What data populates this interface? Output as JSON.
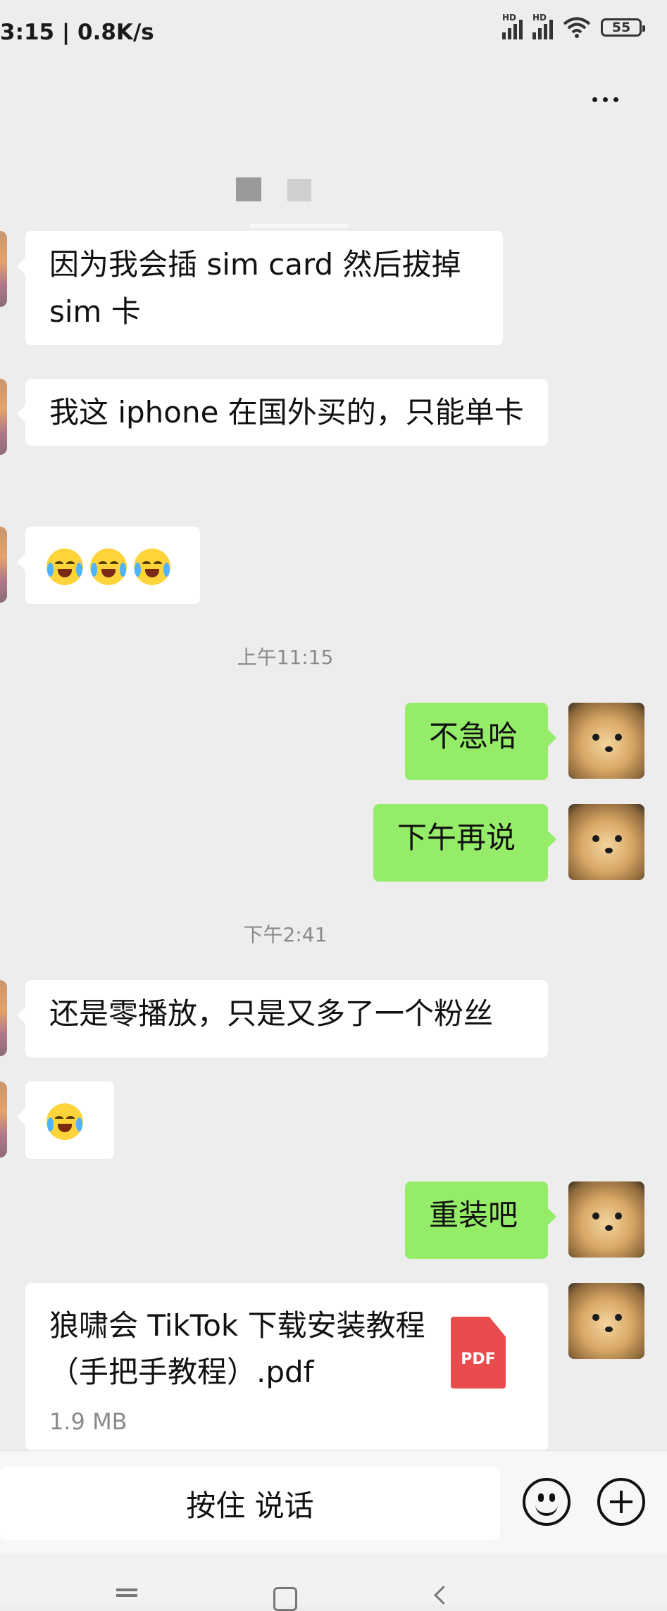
{
  "status_bar": {
    "time_speed": "3:15 | 0.8K/s",
    "sim1_label": "HD",
    "sim2_label": "HD",
    "battery": "55",
    "icons": [
      "signal-icon",
      "signal-icon",
      "wifi-icon",
      "battery-icon"
    ]
  },
  "header": {
    "menu_icon": "more-dots-icon"
  },
  "messages": {
    "m1": "因为我会插 sim card 然后拔掉 sim 卡",
    "m2": "我这 iphone 在国外买的，只能单卡",
    "m6": "还是零播放，只是又多了一个粉丝"
  },
  "timestamps": {
    "t1": "上午11:15",
    "t2": "下午2:41"
  },
  "outgoing": {
    "o1": "不急哈",
    "o2": "下午再说",
    "o3": "重装吧"
  },
  "file_message": {
    "name": "狼啸会 TikTok 下载安装教程（手把手教程）.pdf",
    "size": "1.9 MB",
    "badge": "PDF"
  },
  "input_bar": {
    "voice_label": "按住 说话",
    "emoji_icon": "smiley-icon",
    "plus_icon": "plus-icon"
  },
  "nav_bar": {
    "icons": [
      "menu-icon",
      "home-icon",
      "back-icon"
    ]
  }
}
